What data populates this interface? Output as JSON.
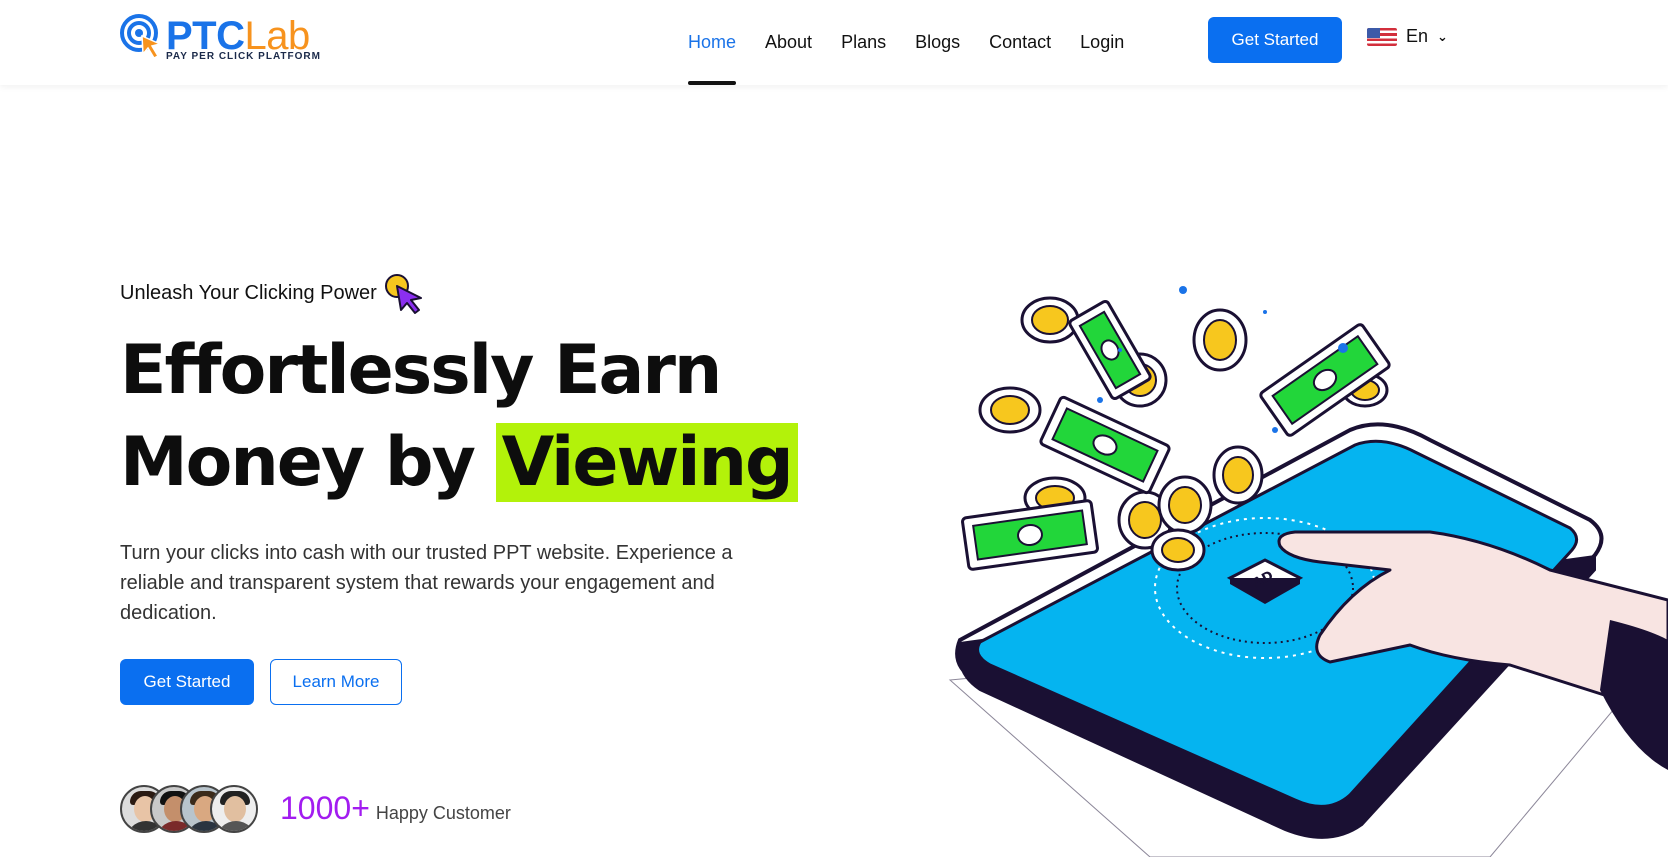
{
  "header": {
    "logo": {
      "brand_main": "PTC",
      "brand_accent": "Lab",
      "tagline": "PAY PER CLICK PLATFORM"
    },
    "nav": [
      {
        "label": "Home",
        "active": true
      },
      {
        "label": "About",
        "active": false
      },
      {
        "label": "Plans",
        "active": false
      },
      {
        "label": "Blogs",
        "active": false
      },
      {
        "label": "Contact",
        "active": false
      },
      {
        "label": "Login",
        "active": false
      }
    ],
    "cta_label": "Get Started",
    "language": {
      "label": "En",
      "flag_icon": "us-flag-icon"
    }
  },
  "hero": {
    "tagline": "Unleash Your Clicking Power",
    "headline_line1": "Effortlessly Earn",
    "headline_line2_prefix": "Money by",
    "headline_highlight": "Viewing",
    "description": "Turn your clicks into cash with our trusted PPT website. Experience a reliable and transparent system that rewards your engagement and dedication.",
    "primary_button": "Get Started",
    "secondary_button": "Learn More",
    "customers_count": "1000+",
    "customers_label": "Happy Customer",
    "art_badge": "AD"
  },
  "colors": {
    "primary": "#0a6ff0",
    "highlight": "#b3f20a",
    "accent_purple": "#a21cf0",
    "logo_orange": "#f7931e",
    "screen_blue": "#05b4f0",
    "cash_green": "#22d63a",
    "coin_yellow": "#f7c71e"
  }
}
